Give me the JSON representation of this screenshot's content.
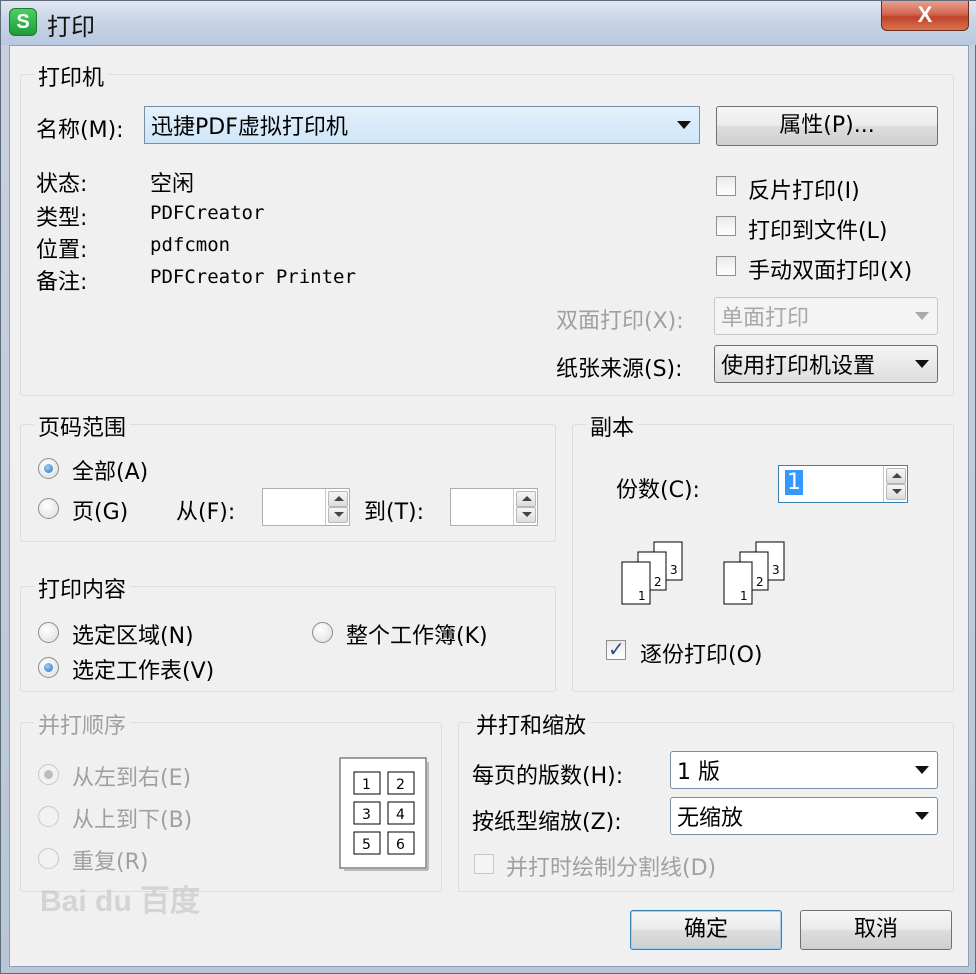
{
  "window": {
    "title": "打印",
    "logo": "S",
    "close": "X"
  },
  "printer": {
    "group_label": "打印机",
    "name_label": "名称(M):",
    "name_value": "迅捷PDF虚拟打印机",
    "properties_button": "属性(P)...",
    "status_label": "状态:",
    "status_value": "空闲",
    "type_label": "类型:",
    "type_value": "PDFCreator",
    "location_label": "位置:",
    "location_value": "pdfcmon",
    "comment_label": "备注:",
    "comment_value": "PDFCreator Printer",
    "reverse_print": "反片打印(I)",
    "print_to_file": "打印到文件(L)",
    "manual_duplex": "手动双面打印(X)",
    "duplex_label": "双面打印(X):",
    "duplex_value": "单面打印",
    "paper_source_label": "纸张来源(S):",
    "paper_source_value": "使用打印机设置"
  },
  "page_range": {
    "group_label": "页码范围",
    "all": "全部(A)",
    "pages": "页(G)",
    "from_label": "从(F):",
    "from_value": "",
    "to_label": "到(T):",
    "to_value": ""
  },
  "copies": {
    "group_label": "副本",
    "count_label": "份数(C):",
    "count_value": "1",
    "stack_pages": [
      "1",
      "2",
      "3"
    ],
    "collate": "逐份打印(O)"
  },
  "print_content": {
    "group_label": "打印内容",
    "selection": "选定区域(N)",
    "workbook": "整个工作簿(K)",
    "active_sheet": "选定工作表(V)"
  },
  "merge_order": {
    "group_label": "并打顺序",
    "left_to_right": "从左到右(E)",
    "top_to_bottom": "从上到下(B)",
    "repeat": "重复(R)",
    "preview_cells": [
      "1",
      "2",
      "3",
      "4",
      "5",
      "6"
    ]
  },
  "merge_zoom": {
    "group_label": "并打和缩放",
    "pages_per_sheet_label": "每页的版数(H):",
    "pages_per_sheet_value": "1 版",
    "scale_label": "按纸型缩放(Z):",
    "scale_value": "无缩放",
    "draw_divider": "并打时绘制分割线(D)"
  },
  "footer": {
    "ok": "确定",
    "cancel": "取消"
  },
  "watermark": "Bai du 百度"
}
